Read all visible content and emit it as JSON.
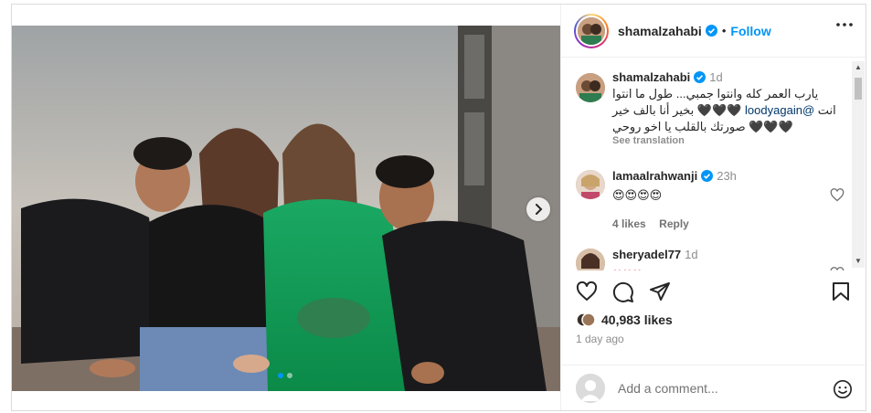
{
  "post": {
    "author": "shamalzahabi",
    "follow_label": "Follow",
    "separator": "•",
    "carousel_dots": 2,
    "active_dot": 0
  },
  "caption": {
    "author": "shamalzahabi",
    "time": "1d",
    "text_line1": "يارب العمر كله وانتوا جمبي... طول ما انتوا",
    "text_line2_prefix": "انت ",
    "mention": "@loodyagain",
    "text_line2_suffix": " 🖤🖤🖤 بخير أنا بالف خير",
    "text_line3": "🖤🖤🖤 صورتك بالقلب يا اخو روحي",
    "see_translation": "See translation"
  },
  "comments": [
    {
      "author": "lamaalrahwanji",
      "time": "23h",
      "text": "😍😍😍😍",
      "likes": "4 likes",
      "reply": "Reply"
    },
    {
      "author": "sheryadel77",
      "time": "1d",
      "text": "❤❤❤"
    }
  ],
  "engagement": {
    "likes": "40,983 likes",
    "date": "1 day ago"
  },
  "add_comment": {
    "placeholder": "Add a comment..."
  },
  "colors": {
    "accent": "#0095f6",
    "verified": "#0095f6",
    "dress": "#14a35a"
  },
  "icons": [
    "verified-icon",
    "more-icon",
    "heart-icon",
    "comment-icon",
    "share-icon",
    "bookmark-icon",
    "emoji-icon",
    "chevron-right-icon"
  ]
}
